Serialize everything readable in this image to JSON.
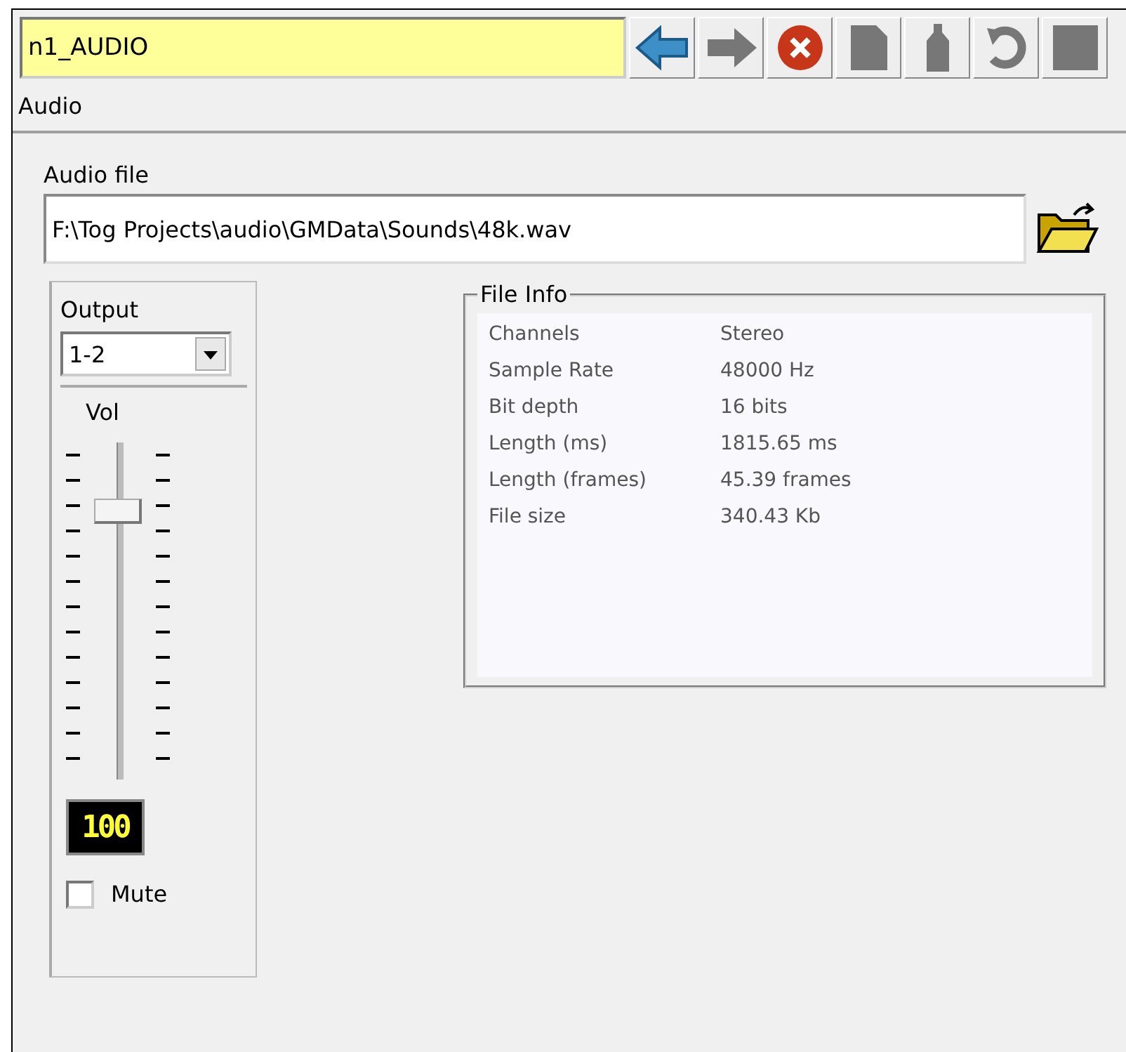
{
  "title_field": {
    "value": "n1_AUDIO"
  },
  "toolbar": [
    {
      "kind": "back"
    },
    {
      "kind": "forward"
    },
    {
      "kind": "close"
    },
    {
      "kind": "page"
    },
    {
      "kind": "bottle"
    },
    {
      "kind": "refresh"
    },
    {
      "kind": "block"
    }
  ],
  "menu": [
    "Audio"
  ],
  "audio_file": {
    "label": "Audio file",
    "value": "F:\\Tog Projects\\audio\\GMData\\Sounds\\48k.wav"
  },
  "output": {
    "label": "Output",
    "select": "1-2",
    "vol_label": "Vol",
    "vol": {
      "level": 0.82
    },
    "display": "100",
    "mute": {
      "label": "Mute",
      "checked": false
    }
  },
  "file_info": {
    "title": "File Info",
    "rows": [
      {
        "label": "Channels",
        "value": "Stereo"
      },
      {
        "label": "Sample Rate",
        "value": "48000 Hz"
      },
      {
        "label": "Bit depth",
        "value": "16 bits"
      },
      {
        "label": "Length (ms)",
        "value": "1815.65 ms"
      },
      {
        "label": "Length (frames)",
        "value": "45.39 frames"
      },
      {
        "label": "File size",
        "value": "340.43 Kb"
      }
    ]
  }
}
